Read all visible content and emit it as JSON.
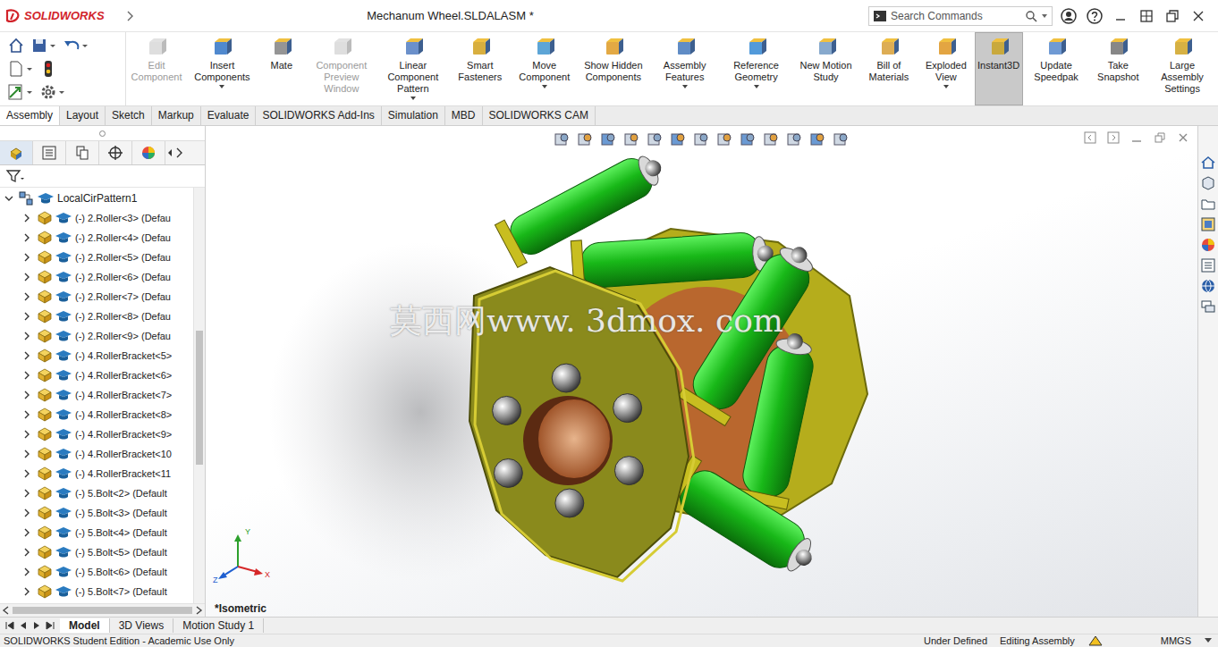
{
  "window": {
    "app": "SOLIDWORKS",
    "title": "Mechanum Wheel.SLDALASM *"
  },
  "search": {
    "placeholder": "Search Commands"
  },
  "ribbon": [
    {
      "label": "Edit Component",
      "disabled": true,
      "dropdown": false,
      "selected": false
    },
    {
      "label": "Insert Components",
      "disabled": false,
      "dropdown": true,
      "selected": false
    },
    {
      "label": "Mate",
      "disabled": false,
      "dropdown": false,
      "selected": false
    },
    {
      "label": "Component Preview Window",
      "disabled": true,
      "dropdown": false,
      "selected": false
    },
    {
      "label": "Linear Component Pattern",
      "disabled": false,
      "dropdown": true,
      "selected": false
    },
    {
      "label": "Smart Fasteners",
      "disabled": false,
      "dropdown": false,
      "selected": false
    },
    {
      "label": "Move Component",
      "disabled": false,
      "dropdown": true,
      "selected": false
    },
    {
      "label": "Show Hidden Components",
      "disabled": false,
      "dropdown": false,
      "selected": false
    },
    {
      "label": "Assembly Features",
      "disabled": false,
      "dropdown": true,
      "selected": false
    },
    {
      "label": "Reference Geometry",
      "disabled": false,
      "dropdown": true,
      "selected": false
    },
    {
      "label": "New Motion Study",
      "disabled": false,
      "dropdown": false,
      "selected": false
    },
    {
      "label": "Bill of Materials",
      "disabled": false,
      "dropdown": false,
      "selected": false
    },
    {
      "label": "Exploded View",
      "disabled": false,
      "dropdown": true,
      "selected": false
    },
    {
      "label": "Instant3D",
      "disabled": false,
      "dropdown": false,
      "selected": true
    },
    {
      "label": "Update Speedpak",
      "disabled": false,
      "dropdown": false,
      "selected": false
    },
    {
      "label": "Take Snapshot",
      "disabled": false,
      "dropdown": false,
      "selected": false
    },
    {
      "label": "Large Assembly Settings",
      "disabled": false,
      "dropdown": false,
      "selected": false
    }
  ],
  "command_tabs": [
    {
      "label": "Assembly",
      "selected": true
    },
    {
      "label": "Layout",
      "selected": false
    },
    {
      "label": "Sketch",
      "selected": false
    },
    {
      "label": "Markup",
      "selected": false
    },
    {
      "label": "Evaluate",
      "selected": false
    },
    {
      "label": "SOLIDWORKS Add-Ins",
      "selected": false
    },
    {
      "label": "Simulation",
      "selected": false
    },
    {
      "label": "MBD",
      "selected": false
    },
    {
      "label": "SOLIDWORKS CAM",
      "selected": false
    }
  ],
  "feature_tree": {
    "root": {
      "label": "LocalCirPattern1",
      "expanded": true
    },
    "items": [
      {
        "label": "(-) 2.Roller<3> (Defau",
        "expanded": false
      },
      {
        "label": "(-) 2.Roller<4> (Defau",
        "expanded": false
      },
      {
        "label": "(-) 2.Roller<5> (Defau",
        "expanded": false
      },
      {
        "label": "(-) 2.Roller<6> (Defau",
        "expanded": false
      },
      {
        "label": "(-) 2.Roller<7> (Defau",
        "expanded": false
      },
      {
        "label": "(-) 2.Roller<8> (Defau",
        "expanded": false
      },
      {
        "label": "(-) 2.Roller<9> (Defau",
        "expanded": false
      },
      {
        "label": "(-) 4.RollerBracket<5>",
        "expanded": false
      },
      {
        "label": "(-) 4.RollerBracket<6>",
        "expanded": false
      },
      {
        "label": "(-) 4.RollerBracket<7>",
        "expanded": false
      },
      {
        "label": "(-) 4.RollerBracket<8>",
        "expanded": false
      },
      {
        "label": "(-) 4.RollerBracket<9>",
        "expanded": false
      },
      {
        "label": "(-) 4.RollerBracket<10",
        "expanded": false
      },
      {
        "label": "(-) 4.RollerBracket<11",
        "expanded": false
      },
      {
        "label": "(-) 5.Bolt<2> (Default",
        "expanded": false
      },
      {
        "label": "(-) 5.Bolt<3> (Default",
        "expanded": false
      },
      {
        "label": "(-) 5.Bolt<4> (Default",
        "expanded": false
      },
      {
        "label": "(-) 5.Bolt<5> (Default",
        "expanded": false
      },
      {
        "label": "(-) 5.Bolt<6> (Default",
        "expanded": false
      },
      {
        "label": "(-) 5.Bolt<7> (Default",
        "expanded": false
      }
    ]
  },
  "viewport": {
    "view_label": "*Isometric",
    "watermark": "莫西网www. 3dmox. com",
    "axes": [
      "Y",
      "X",
      "Z"
    ]
  },
  "bottom_tabs": [
    {
      "label": "Model",
      "selected": true
    },
    {
      "label": "3D Views",
      "selected": false
    },
    {
      "label": "Motion Study 1",
      "selected": false
    }
  ],
  "status_bar": {
    "left": "SOLIDWORKS Student Edition - Academic Use Only",
    "items": [
      "Under Defined",
      "Editing Assembly",
      "MMGS"
    ]
  }
}
